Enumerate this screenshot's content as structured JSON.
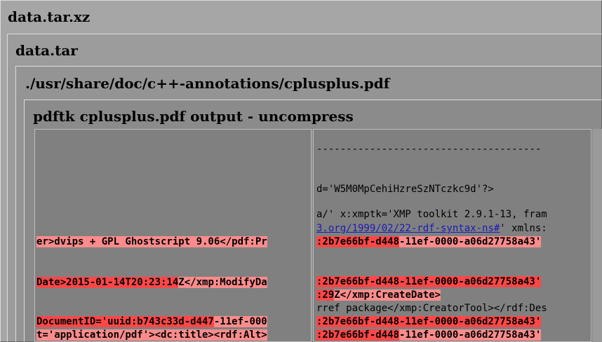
{
  "window": {
    "title": "data.tar.xz",
    "archive": "data.tar",
    "file_path": "./usr/share/doc/c++-annotations/cplusplus.pdf",
    "panel_title": "pdftk cplusplus.pdf output - uncompress"
  },
  "left_column": {
    "line_producer": {
      "a": "er>dvips + GPL Ghostscript 9.06</pdf:Pr"
    },
    "line_modify": {
      "a": "Date>2015-01-14T20:23:14",
      "b": "Z</xmp:ModifyDa"
    },
    "line_docid": {
      "a": "DocumentID='uuid:b743c33d-d447",
      "b": "-11ef-000"
    },
    "line_format": {
      "a": "t='application/pdf'><dc:title><rdf:Alt>"
    }
  },
  "right_column": {
    "dashes": "--------------------------------------",
    "line_id": "d='W5M0MpCehiHzreSzNTczkc9d'?>",
    "line_xmptk": "a/' x:xmptk='XMP toolkit 2.9.1-13, fram",
    "line_rdf": {
      "link": "3.org/1999/02/22-rdf-syntax-ns#",
      "rest": "' xmlns:"
    },
    "line_uuid1": {
      "a": ":2b7e66bf-d448",
      "b": "-11ef-0000-a06d27758a43'"
    },
    "line_uuid2": {
      "a": ":2b7e66bf-d448-11ef-0000-a06d27758a43'"
    },
    "line_create": {
      "a": ":29",
      "b": "Z</xmp:CreateDate>"
    },
    "line_tool": "rref package</xmp:CreatorTool></rdf:Des",
    "line_uuid3": {
      "a": ":2b7e66bf-d448-11ef-0000-a06d27758a43'"
    },
    "line_uuid4": {
      "a": ":2b7e66bf-d448",
      "b": "-11ef-0000-a06d27758a43'"
    }
  }
}
